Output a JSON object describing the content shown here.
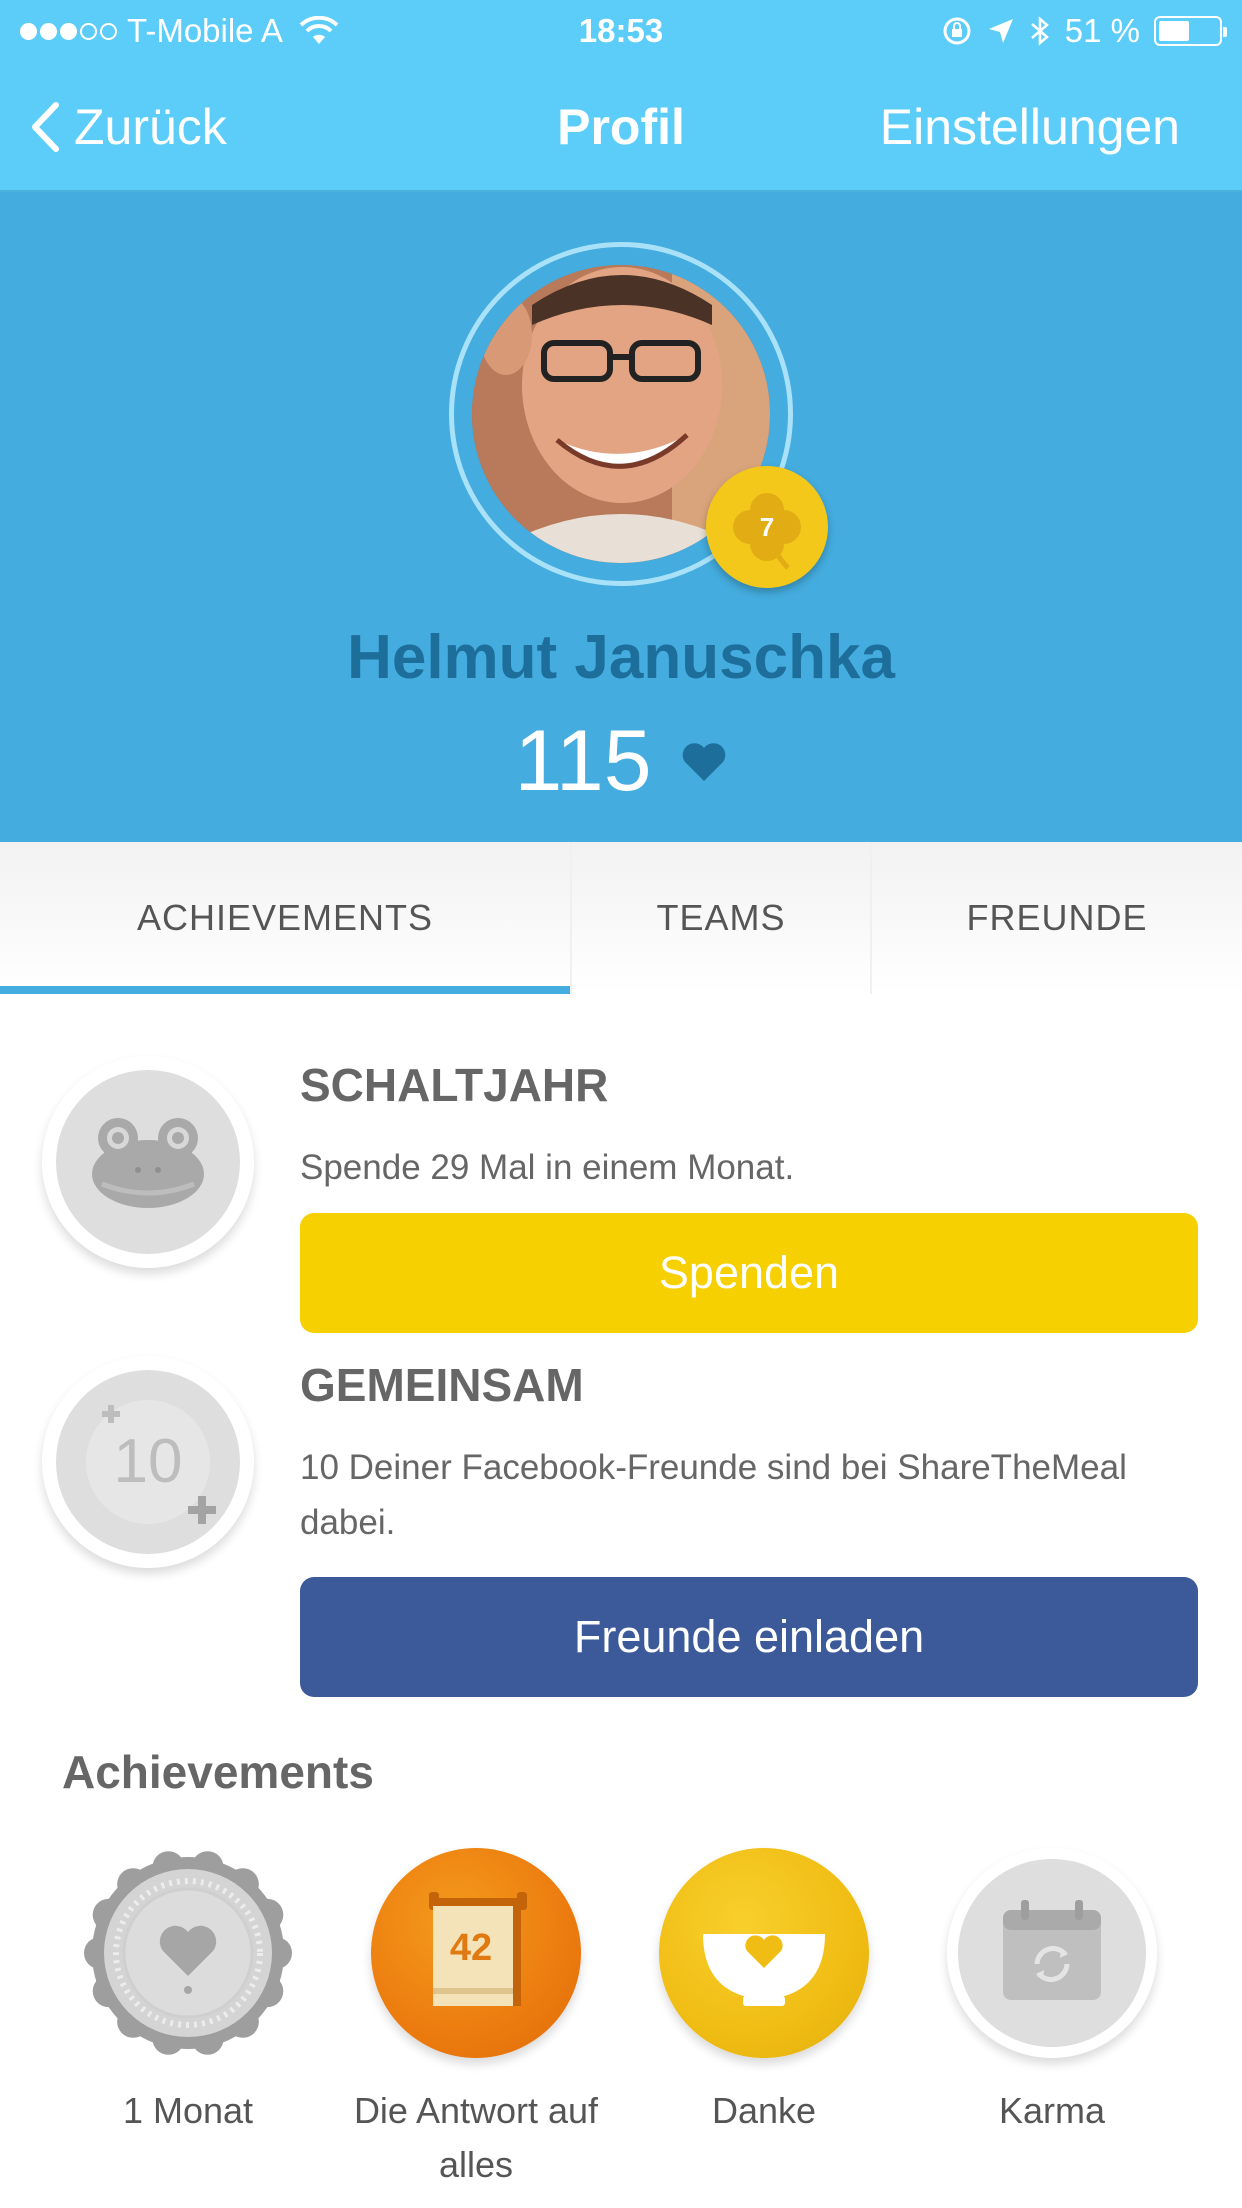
{
  "status_bar": {
    "carrier": "T-Mobile A",
    "time": "18:53",
    "battery_percent": "51 %",
    "battery_level": 0.51,
    "signal_bars": 3
  },
  "nav": {
    "back_label": "Zurück",
    "title": "Profil",
    "settings_label": "Einstellungen"
  },
  "profile": {
    "name": "Helmut Januschka",
    "level": "7",
    "meals_count": "115"
  },
  "tabs": [
    {
      "label": "ACHIEVEMENTS",
      "active": true
    },
    {
      "label": "TEAMS",
      "active": false
    },
    {
      "label": "FREUNDE",
      "active": false
    }
  ],
  "challenges": [
    {
      "title": "SCHALTJAHR",
      "description": "Spende 29 Mal in einem Monat.",
      "button_label": "Spenden",
      "icon": "frog-icon"
    },
    {
      "title": "GEMEINSAM",
      "description": "10 Deiner Facebook-Freunde sind bei ShareTheMeal dabei.",
      "button_label": "Freunde einladen",
      "icon": "ten-plus-icon",
      "icon_text": "10"
    }
  ],
  "achievements": {
    "heading": "Achievements",
    "items": [
      {
        "label": "1 Monat",
        "icon": "heart-medal-icon"
      },
      {
        "label": "Die Antwort auf alles",
        "icon": "towel-42-icon",
        "icon_text": "42"
      },
      {
        "label": "Danke",
        "icon": "bowl-heart-icon"
      },
      {
        "label": "Karma",
        "icon": "calendar-cycle-icon"
      }
    ]
  },
  "colors": {
    "nav_bar": "#5ccdf9",
    "header": "#44acde",
    "name": "#1d6e9a",
    "yellow_button": "#f6d000",
    "facebook_button": "#3c5a99"
  }
}
